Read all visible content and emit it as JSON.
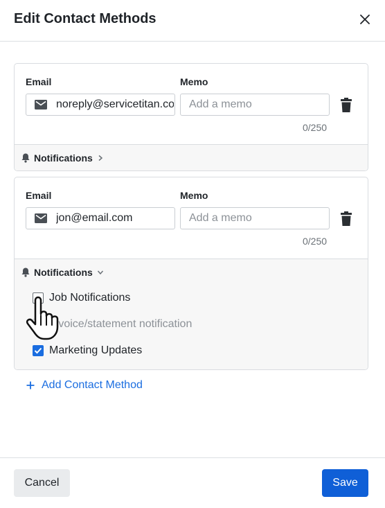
{
  "dialog": {
    "title": "Edit Contact Methods",
    "close_icon": "close-icon"
  },
  "contacts": [
    {
      "type_label": "Email",
      "memo_label": "Memo",
      "value": "noreply@servicetitan.com",
      "memo_placeholder": "Add a memo",
      "counter": "0/250",
      "notifications_label": "Notifications",
      "expanded": false
    },
    {
      "type_label": "Email",
      "memo_label": "Memo",
      "value": "jon@email.com",
      "memo_placeholder": "Add a memo",
      "counter": "0/250",
      "notifications_label": "Notifications",
      "expanded": true,
      "options": [
        {
          "label": "Job Notifications",
          "checked": false,
          "disabled": false
        },
        {
          "label": "Invoice/statement notification",
          "checked": false,
          "disabled": true
        },
        {
          "label": "Marketing Updates",
          "checked": true,
          "disabled": false
        }
      ]
    }
  ],
  "add_contact_label": "Add Contact Method",
  "footer": {
    "cancel_label": "Cancel",
    "save_label": "Save"
  },
  "colors": {
    "primary": "#0f5fd7",
    "link": "#1a6de0",
    "checkbox_checked": "#1a6de0"
  }
}
